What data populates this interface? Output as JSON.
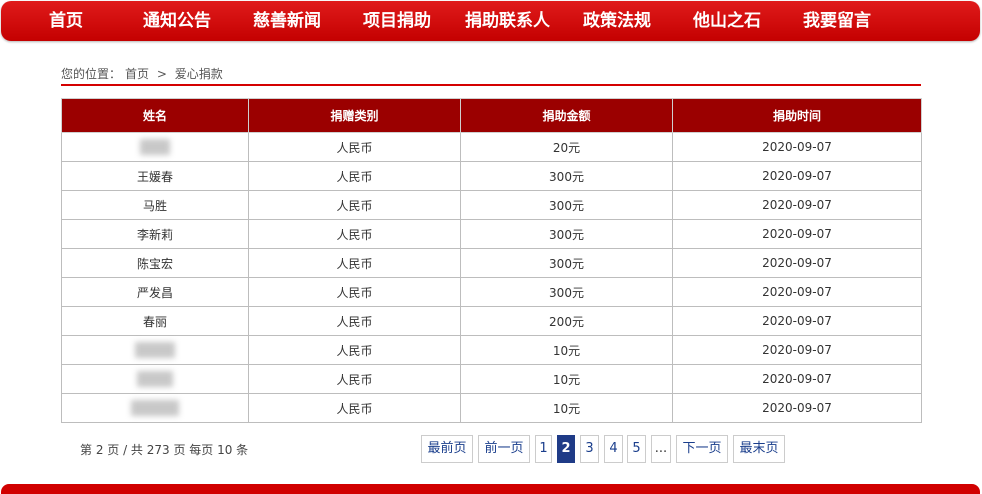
{
  "nav": {
    "items": [
      {
        "label": "首页"
      },
      {
        "label": "通知公告"
      },
      {
        "label": "慈善新闻"
      },
      {
        "label": "项目捐助"
      },
      {
        "label": "捐助联系人"
      },
      {
        "label": "政策法规"
      },
      {
        "label": "他山之石"
      },
      {
        "label": "我要留言"
      }
    ]
  },
  "breadcrumb": {
    "prefix": "您的位置：",
    "home": "首页",
    "separator": ">",
    "current": "爱心捐款"
  },
  "table": {
    "headers": [
      "姓名",
      "捐赠类别",
      "捐助金额",
      "捐助时间"
    ],
    "rows": [
      {
        "name": "",
        "type": "人民币",
        "amount": "20元",
        "date": "2020-09-07"
      },
      {
        "name": "王媛春",
        "type": "人民币",
        "amount": "300元",
        "date": "2020-09-07"
      },
      {
        "name": "马胜",
        "type": "人民币",
        "amount": "300元",
        "date": "2020-09-07"
      },
      {
        "name": "李新莉",
        "type": "人民币",
        "amount": "300元",
        "date": "2020-09-07"
      },
      {
        "name": "陈宝宏",
        "type": "人民币",
        "amount": "300元",
        "date": "2020-09-07"
      },
      {
        "name": "严发昌",
        "type": "人民币",
        "amount": "300元",
        "date": "2020-09-07"
      },
      {
        "name": "春丽",
        "type": "人民币",
        "amount": "200元",
        "date": "2020-09-07"
      },
      {
        "name": "",
        "type": "人民币",
        "amount": "10元",
        "date": "2020-09-07"
      },
      {
        "name": "",
        "type": "人民币",
        "amount": "10元",
        "date": "2020-09-07"
      },
      {
        "name": "",
        "type": "人民币",
        "amount": "10元",
        "date": "2020-09-07"
      }
    ]
  },
  "pagination": {
    "info": "第 2 页 / 共 273 页 每页 10 条",
    "first": "最前页",
    "prev": "前一页",
    "pages": [
      "1",
      "2",
      "3",
      "4",
      "5"
    ],
    "current": "2",
    "ellipsis": "...",
    "next": "下一页",
    "last": "最末页"
  }
}
